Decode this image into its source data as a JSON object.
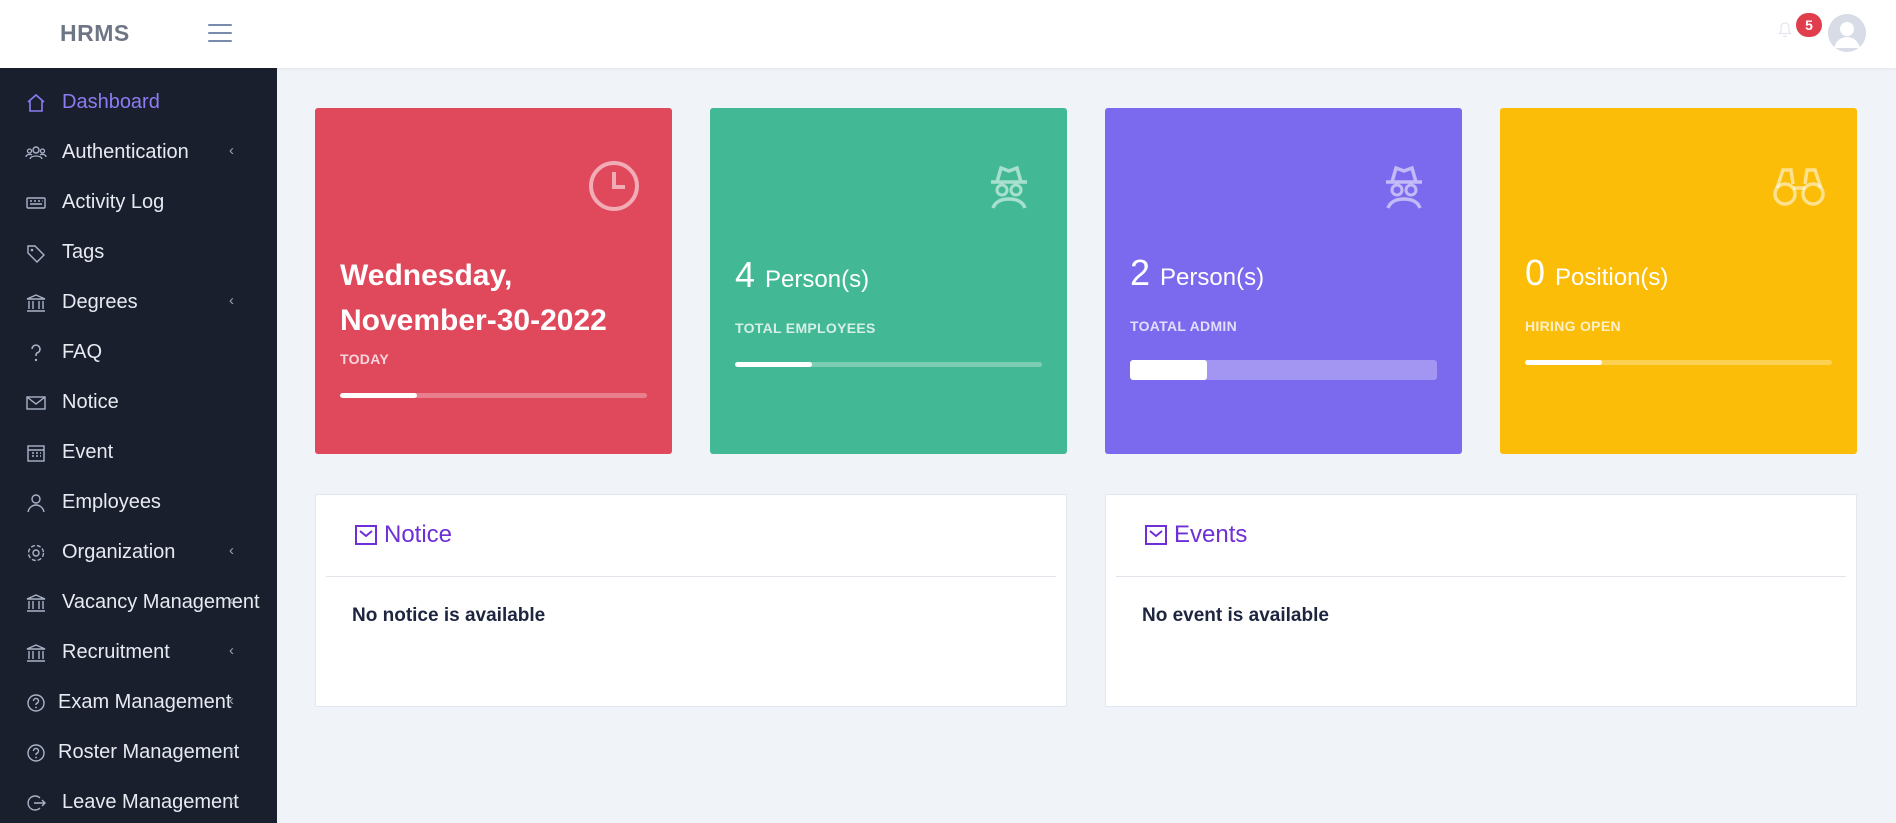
{
  "app": {
    "brand": "HRMS",
    "notification_count": "5"
  },
  "sidebar": {
    "items": [
      {
        "label": "Dashboard",
        "icon": "home-icon",
        "caret": false,
        "active": true
      },
      {
        "label": "Authentication",
        "icon": "users-icon",
        "caret": true
      },
      {
        "label": "Activity Log",
        "icon": "keyboard-icon",
        "caret": false
      },
      {
        "label": "Tags",
        "icon": "tag-icon",
        "caret": false
      },
      {
        "label": "Degrees",
        "icon": "bank-icon",
        "caret": true
      },
      {
        "label": "FAQ",
        "icon": "question-icon",
        "caret": false
      },
      {
        "label": "Notice",
        "icon": "mail-icon",
        "caret": false
      },
      {
        "label": "Event",
        "icon": "calendar-icon",
        "caret": false
      },
      {
        "label": "Employees",
        "icon": "user-icon",
        "caret": false
      },
      {
        "label": "Organization",
        "icon": "gear-icon",
        "caret": true
      },
      {
        "label": "Vacancy Management",
        "icon": "bank-icon",
        "caret": true
      },
      {
        "label": "Recruitment",
        "icon": "bank-icon",
        "caret": true
      },
      {
        "label": "Exam Management",
        "icon": "question-circle-icon",
        "caret": true
      },
      {
        "label": "Roster Management",
        "icon": "question-circle-icon",
        "caret": true
      },
      {
        "label": "Leave Management",
        "icon": "logout-icon",
        "caret": true
      }
    ]
  },
  "cards": {
    "today": {
      "title": "Wednesday, November-30-2022",
      "label": "TODAY",
      "progress": 0.25,
      "color": "#e0485c"
    },
    "employees": {
      "count": "4",
      "unit": "Person(s)",
      "label": "TOTAL EMPLOYEES",
      "progress": 0.25,
      "color": "#42b994"
    },
    "admin": {
      "count": "2",
      "unit": "Person(s)",
      "label": "TOATAL ADMIN",
      "progress": 0.25,
      "color": "#7b69ee"
    },
    "hiring": {
      "count": "0",
      "unit": "Position(s)",
      "label": "HIRING OPEN",
      "progress": 0.25,
      "color": "#fbbd08"
    }
  },
  "panels": {
    "notice": {
      "title": "Notice",
      "empty_text": "No notice is available"
    },
    "events": {
      "title": "Events",
      "empty_text": "No event is available"
    }
  },
  "colors": {
    "sidebar_bg": "#1a1f2e",
    "accent": "#8c7cf2",
    "panel_title": "#6f2fd6"
  }
}
